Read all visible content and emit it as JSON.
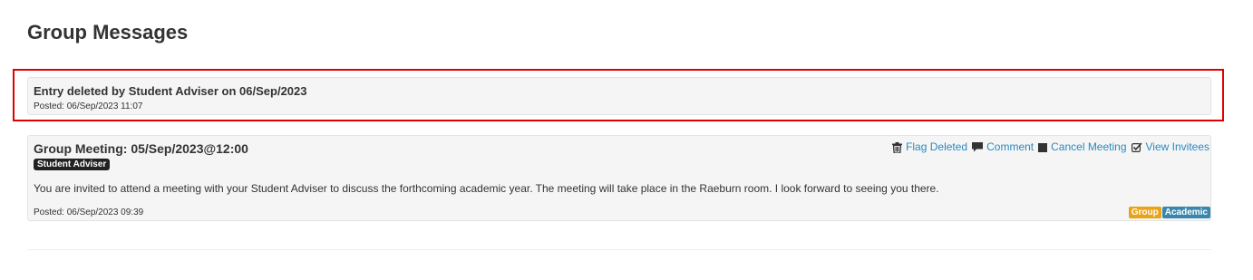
{
  "page": {
    "title": "Group Messages"
  },
  "entries": [
    {
      "title": "Entry deleted by Student Adviser on 06/Sep/2023",
      "posted": "Posted: 06/Sep/2023 11:07"
    },
    {
      "title": "Group Meeting: 05/Sep/2023@12:00",
      "role": "Student Adviser",
      "body": "You are invited to attend a meeting with your Student Adviser to discuss the forthcoming academic year. The meeting will take place in the Raeburn room. I look forward to seeing you there.",
      "posted": "Posted: 06/Sep/2023 09:39",
      "actions": {
        "flag_deleted": "Flag Deleted",
        "comment": "Comment",
        "cancel_meeting": "Cancel Meeting",
        "view_invitees": "View Invitees"
      },
      "icons": {
        "flag_deleted": "trash-icon",
        "comment": "comment-icon",
        "cancel_meeting": "stop-square-icon",
        "view_invitees": "checkbox-check-icon"
      },
      "tags": [
        "Group",
        "Academic"
      ]
    }
  ],
  "colors": {
    "highlight_border": "#e00000",
    "link": "#2a8ac0",
    "tag_group": "#e8a318",
    "tag_academic": "#3a87ad",
    "role_badge": "#222222"
  }
}
